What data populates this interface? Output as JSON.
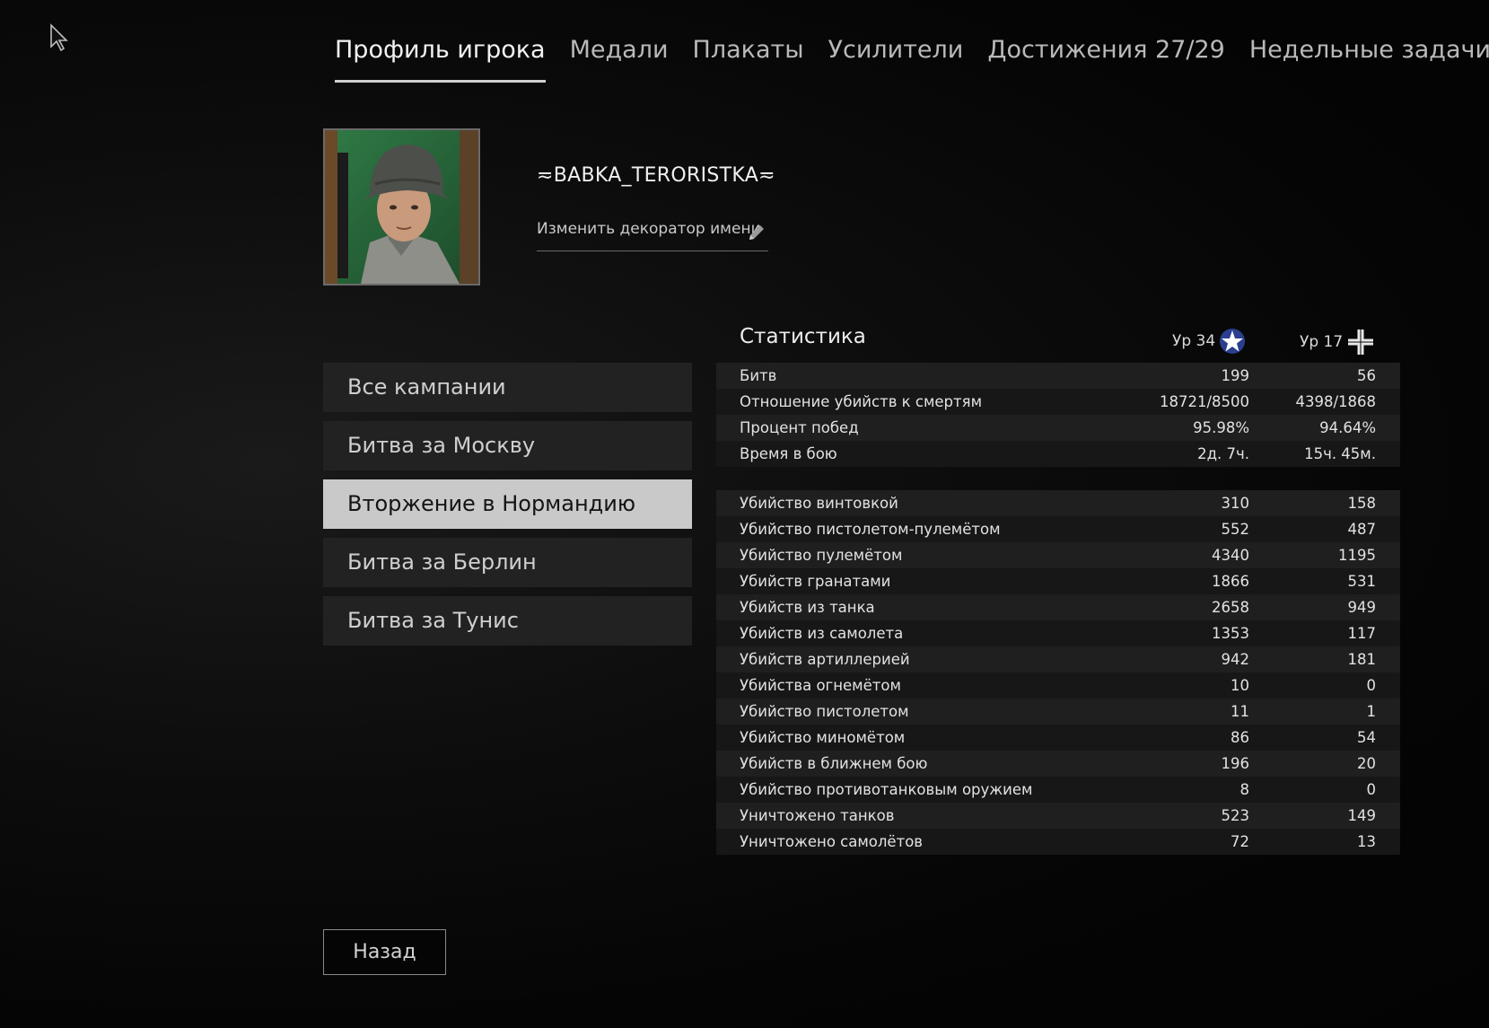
{
  "tabs": [
    {
      "label": "Профиль игрока",
      "active": true
    },
    {
      "label": "Медали",
      "active": false
    },
    {
      "label": "Плакаты",
      "active": false
    },
    {
      "label": "Усилители",
      "active": false
    },
    {
      "label": "Достижения 27/29",
      "active": false
    },
    {
      "label": "Недельные задачи",
      "active": false
    }
  ],
  "profile": {
    "name": "≂BABKA_TERORISTKA≂",
    "change_decorator": "Изменить декоратор имени",
    "avatar_icon": "soldier-portrait"
  },
  "campaigns": [
    {
      "label": "Все кампании",
      "active": false
    },
    {
      "label": "Битва за Москву",
      "active": false
    },
    {
      "label": "Вторжение в Нормандию",
      "active": true
    },
    {
      "label": "Битва за Берлин",
      "active": false
    },
    {
      "label": "Битва за Тунис",
      "active": false
    }
  ],
  "stats": {
    "title": "Статистика",
    "level_allies": "Ур 34",
    "level_axis": "Ур 17",
    "allies_icon": "allied-star-icon",
    "axis_icon": "balkenkreuz-icon",
    "summary": [
      {
        "label": "Битв",
        "allies": "199",
        "axis": "56"
      },
      {
        "label": "Отношение убийств к смертям",
        "allies": "18721/8500",
        "axis": "4398/1868"
      },
      {
        "label": "Процент побед",
        "allies": "95.98%",
        "axis": "94.64%"
      },
      {
        "label": "Время в бою",
        "allies": "2д. 7ч.",
        "axis": "15ч. 45м."
      }
    ],
    "details": [
      {
        "label": "Убийство винтовкой",
        "allies": "310",
        "axis": "158"
      },
      {
        "label": "Убийство пистолетом-пулемётом",
        "allies": "552",
        "axis": "487"
      },
      {
        "label": "Убийство пулемётом",
        "allies": "4340",
        "axis": "1195"
      },
      {
        "label": "Убийств гранатами",
        "allies": "1866",
        "axis": "531"
      },
      {
        "label": "Убийств из танка",
        "allies": "2658",
        "axis": "949"
      },
      {
        "label": "Убийств из самолета",
        "allies": "1353",
        "axis": "117"
      },
      {
        "label": "Убийств артиллерией",
        "allies": "942",
        "axis": "181"
      },
      {
        "label": "Убийства огнемётом",
        "allies": "10",
        "axis": "0"
      },
      {
        "label": "Убийство пистолетом",
        "allies": "11",
        "axis": "1"
      },
      {
        "label": "Убийство миномётом",
        "allies": "86",
        "axis": "54"
      },
      {
        "label": "Убийств в ближнем бою",
        "allies": "196",
        "axis": "20"
      },
      {
        "label": "Убийство противотанковым оружием",
        "allies": "8",
        "axis": "0"
      },
      {
        "label": "Уничтожено танков",
        "allies": "523",
        "axis": "149"
      },
      {
        "label": "Уничтожено самолётов",
        "allies": "72",
        "axis": "13"
      }
    ]
  },
  "back_label": "Назад"
}
